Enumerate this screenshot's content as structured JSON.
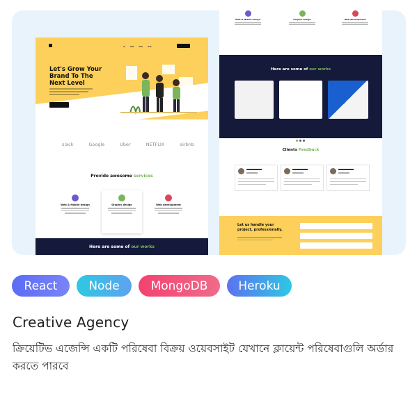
{
  "project": {
    "title": "Creative Agency",
    "description": "ক্রিয়েটিভ এজেন্সি একটি পরিষেবা বিক্রয় ওয়েবসাইট যেখানে ক্লায়েন্ট পরিষেবাগুলি অর্ডার করতে পারবে",
    "tags": [
      "React",
      "Node",
      "MongoDB",
      "Heroku"
    ]
  },
  "preview": {
    "left": {
      "headline": "Let's Grow Your Brand To The Next Level",
      "brands": [
        "slack",
        "Google",
        "Uber",
        "NETFLIX",
        "airbnb"
      ],
      "services_title_prefix": "Provide awesome",
      "services_title_highlight": "services",
      "services": [
        "Web & Mobile design",
        "Graphic design",
        "Web development"
      ],
      "works_title_prefix": "Here are some of",
      "works_title_highlight": "our works"
    },
    "right": {
      "services": [
        "Web & Mobile design",
        "Graphic design",
        "Web development"
      ],
      "works_title_prefix": "Here are some of",
      "works_title_highlight": "our works",
      "feedback_title_prefix": "Clients",
      "feedback_title_highlight": "Feedback",
      "contact_title": "Let us handle your project, professionally."
    },
    "colors": {
      "yellow": "#fcd05a",
      "navy": "#151a3b",
      "green": "#7ab55c",
      "background": "#e9f3fb"
    }
  },
  "tag_colors": {
    "react": "#5b6cf5",
    "node": "#2ec8e3",
    "mongodb": "#f3426f",
    "heroku": "#5d72ef"
  }
}
